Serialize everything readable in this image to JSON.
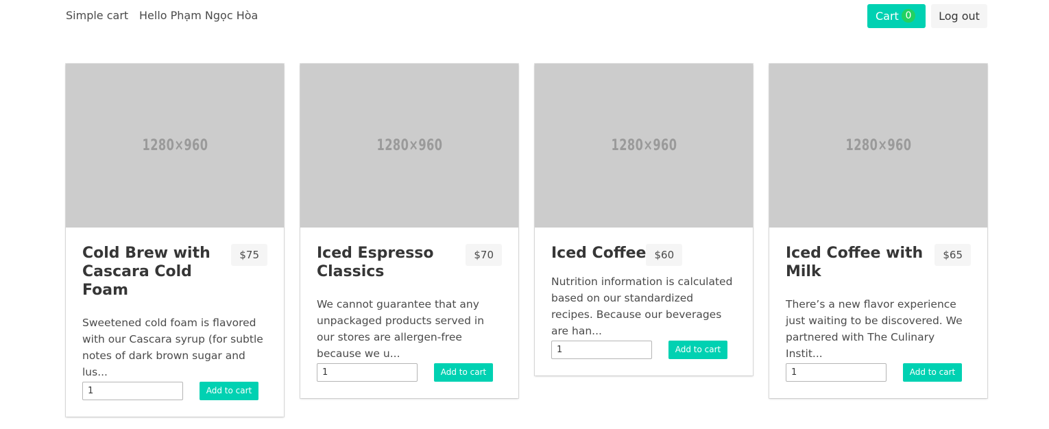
{
  "navbar": {
    "brand": "Simple cart",
    "greeting": "Hello Phạm Ngọc Hòa",
    "cart_label": "Cart",
    "cart_count": "0",
    "logout_label": "Log out"
  },
  "colors": {
    "primary": "#00d1b2",
    "success": "#23d160",
    "placeholder_bg": "#cccccc"
  },
  "products": [
    {
      "image_text": "1280×960",
      "title": "Cold Brew with Cascara Cold Foam",
      "price": "$75",
      "description": "Sweetened cold foam is flavored with our Cascara syrup (for subtle notes of dark brown sugar and lus...",
      "quantity": "1",
      "add_label": "Add to cart"
    },
    {
      "image_text": "1280×960",
      "title": "Iced Espresso Classics",
      "price": "$70",
      "description": "We cannot guarantee that any unpackaged products served in our stores are allergen-free because we u...",
      "quantity": "1",
      "add_label": "Add to cart"
    },
    {
      "image_text": "1280×960",
      "title": "Iced Coffee",
      "price": "$60",
      "description": "Nutrition information is calculated based on our standardized recipes. Because our beverages are han...",
      "quantity": "1",
      "add_label": "Add to cart"
    },
    {
      "image_text": "1280×960",
      "title": "Iced Coffee with Milk",
      "price": "$65",
      "description": "There’s a new flavor experience just waiting to be discovered. We partnered with The Culinary Instit...",
      "quantity": "1",
      "add_label": "Add to cart"
    }
  ]
}
